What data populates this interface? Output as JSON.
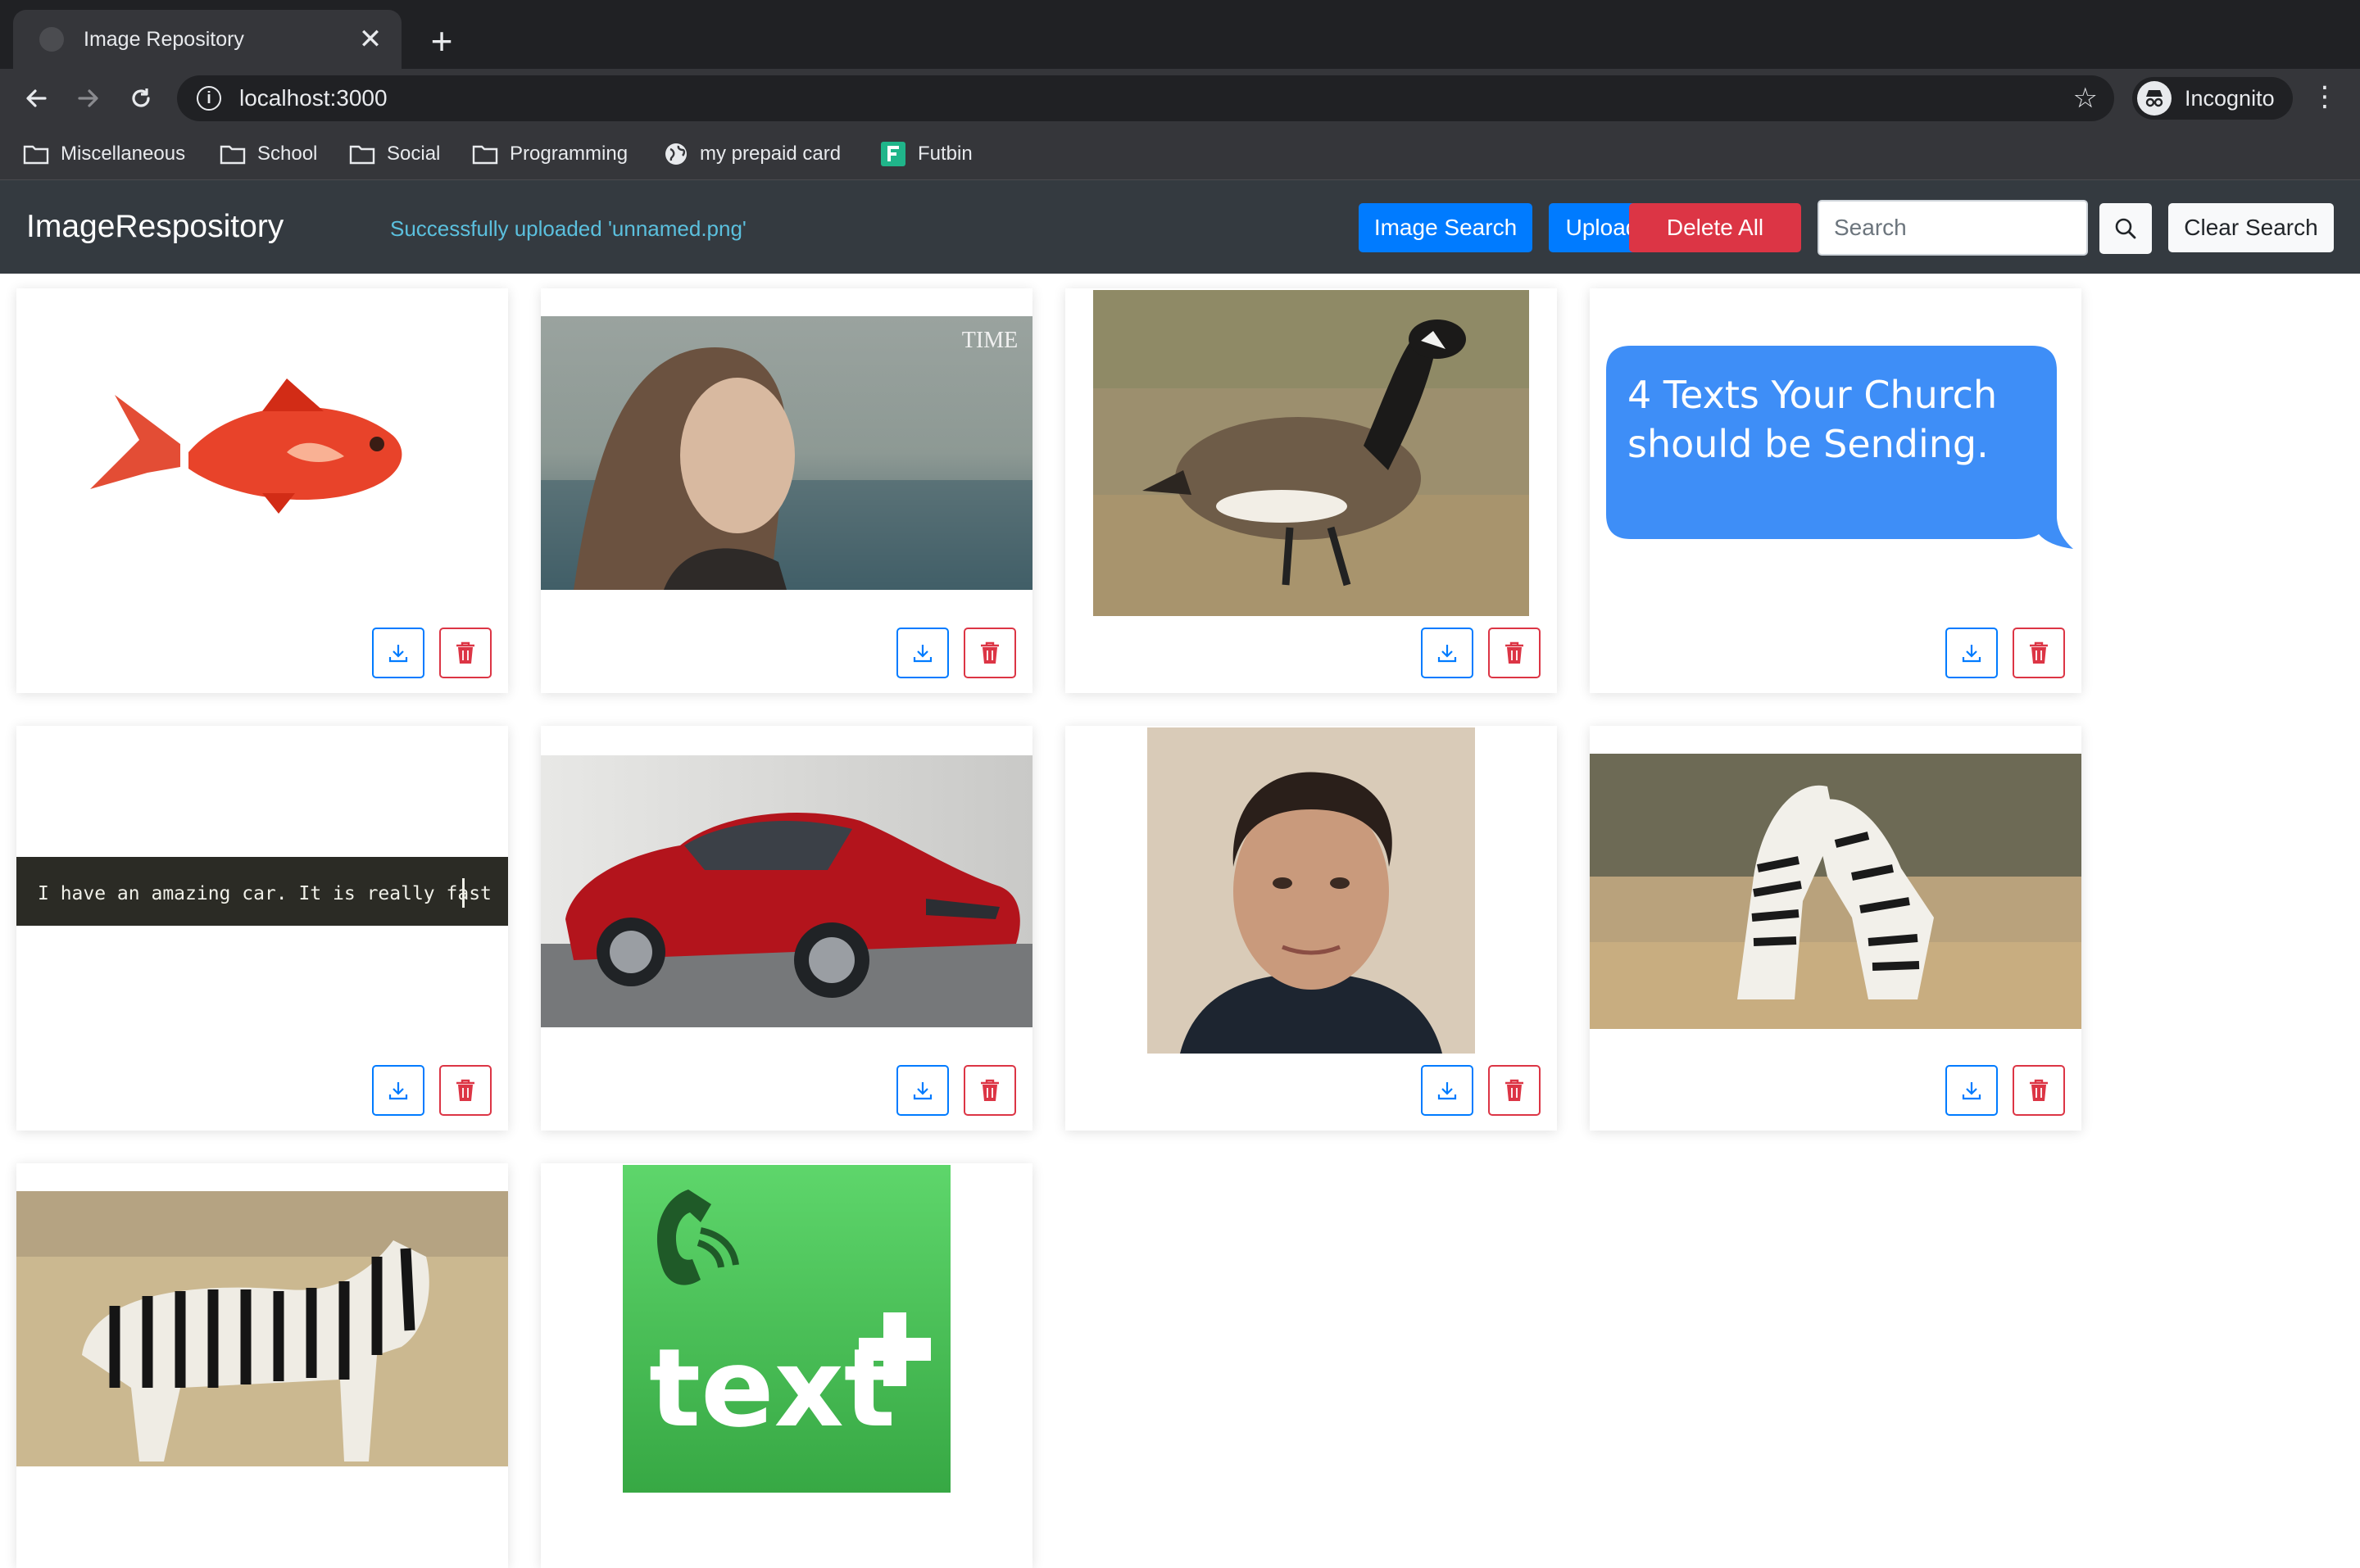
{
  "browser": {
    "tab_title": "Image Repository",
    "tab_close": "✕",
    "new_tab": "+",
    "url": "localhost:3000",
    "profile_label": "Incognito",
    "menu": "⋮",
    "bookmarks": [
      {
        "label": "Miscellaneous",
        "icon": "folder-icon"
      },
      {
        "label": "School",
        "icon": "folder-icon"
      },
      {
        "label": "Social",
        "icon": "folder-icon"
      },
      {
        "label": "Programming",
        "icon": "folder-icon"
      },
      {
        "label": "my prepaid card",
        "icon": "globe-icon"
      },
      {
        "label": "Futbin",
        "icon": "futbin-logo"
      }
    ]
  },
  "app": {
    "brand": "ImageRespository",
    "status_message": "Successfully uploaded 'unnamed.png'",
    "image_search_label": "Image Search",
    "upload_label": "Upload",
    "delete_all_label": "Delete All",
    "search_placeholder": "Search",
    "clear_search_label": "Clear Search",
    "colors": {
      "primary": "#007bff",
      "danger": "#dc3545",
      "navbar": "#343a40",
      "status": "#5bc0de"
    }
  },
  "gallery": {
    "images": [
      {
        "subject": "goldfish"
      },
      {
        "subject": "portrait-time-cover",
        "text": "TIME"
      },
      {
        "subject": "canada-goose"
      },
      {
        "subject": "text-bubble",
        "text_line1": "4 Texts Your Church",
        "text_line2": "should be Sending."
      },
      {
        "subject": "terminal-text",
        "text": "I have an amazing car. It is really fast"
      },
      {
        "subject": "red-car"
      },
      {
        "subject": "man-portrait"
      },
      {
        "subject": "fighting-zebras"
      },
      {
        "subject": "zebra"
      },
      {
        "subject": "textplus-logo",
        "text": "text"
      }
    ]
  }
}
